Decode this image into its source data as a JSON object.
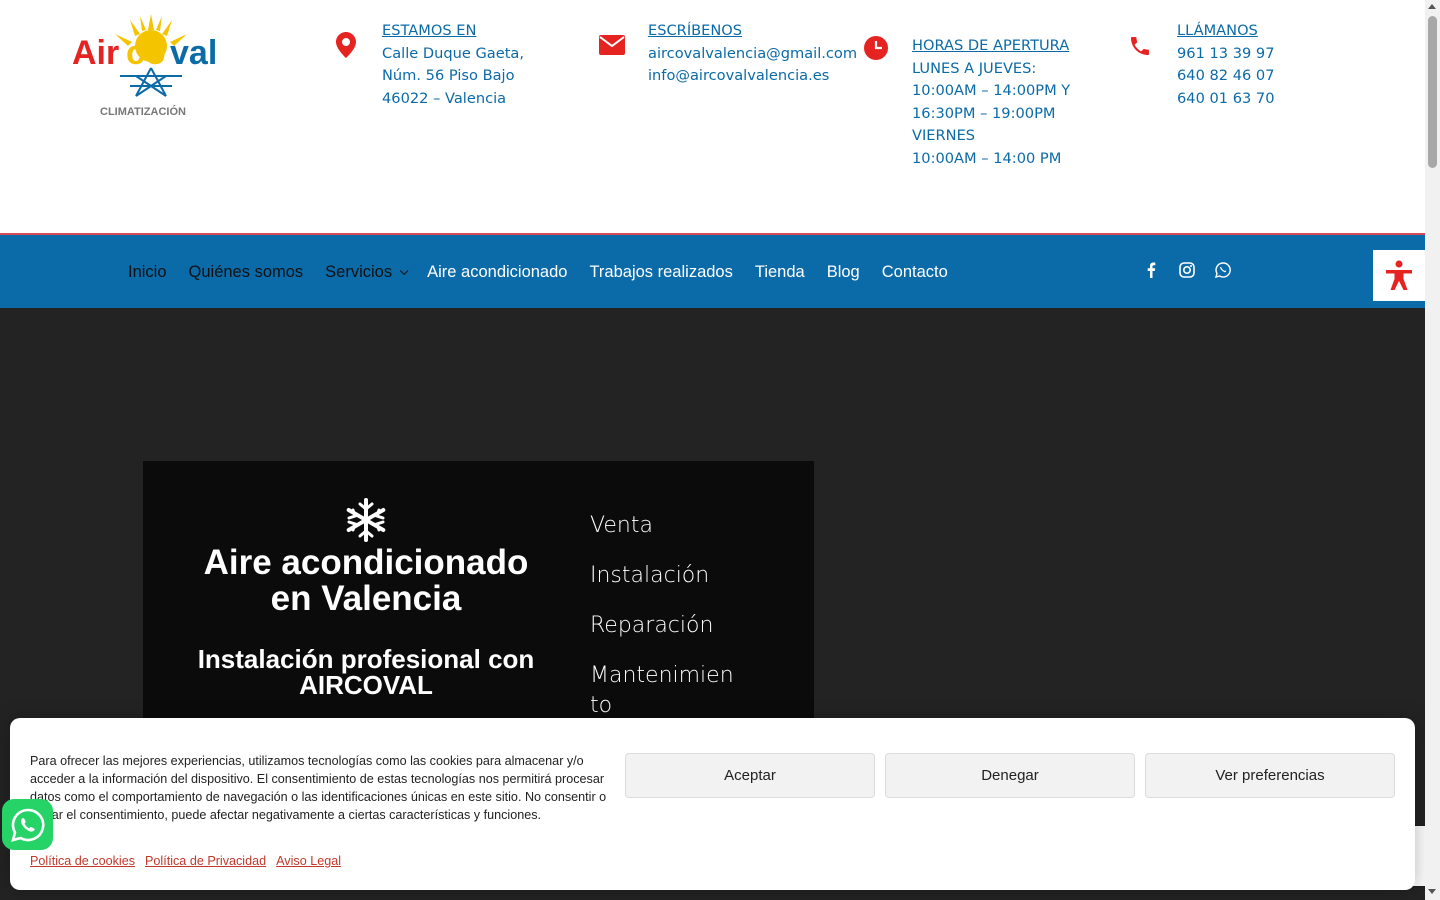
{
  "header": {
    "logo_text": "Aircoval",
    "logo_subtext": "CLIMATIZACIÓN",
    "location": {
      "title": "ESTAMOS EN",
      "lines": [
        "Calle Duque Gaeta,",
        "Núm. 56 Piso Bajo",
        "46022 – Valencia"
      ]
    },
    "email": {
      "title": "ESCRÍBENOS",
      "lines": [
        "aircovalvalencia@gmail.com",
        "info@aircovalvalencia.es"
      ]
    },
    "hours": {
      "title": "HORAS DE APERTURA",
      "lines": [
        "LUNES A JUEVES:",
        "10:00AM – 14:00PM Y",
        "16:30PM – 19:00PM",
        "VIERNES",
        "10:00AM – 14:00 PM"
      ]
    },
    "phone": {
      "title": " LLÁMANOS",
      "lines": [
        "961 13 39 97",
        "640 82 46 07",
        "640 01 63 70"
      ]
    }
  },
  "nav": {
    "items": [
      "Inicio",
      "Quiénes somos",
      "Servicios",
      "Aire acondicionado",
      "Trabajos realizados",
      "Tienda",
      "Blog",
      "Contacto"
    ]
  },
  "hero": {
    "title": "Aire acondicionado en Valencia",
    "subtitle": "Instalación profesional con AIRCOVAL",
    "services": [
      "Venta",
      "Instalación",
      "Reparación",
      "Mantenimiento"
    ]
  },
  "cookie": {
    "text": "Para ofrecer las mejores experiencias, utilizamos tecnologías como las cookies para almacenar y/o acceder a la información del dispositivo. El consentimiento de estas tecnologías nos permitirá procesar datos como el comportamiento de navegación o las identificaciones únicas en este sitio. No consentir o retirar el consentimiento, puede afectar negativamente a ciertas características y funciones.",
    "accept": "Aceptar",
    "deny": "Denegar",
    "preferences": "Ver preferencias",
    "links": [
      "Política de cookies",
      "Política de Privacidad",
      "Aviso Legal"
    ]
  },
  "colors": {
    "brand_blue": "#0b6aa8",
    "accent_red": "#e52321",
    "hero_bg": "#232323"
  }
}
